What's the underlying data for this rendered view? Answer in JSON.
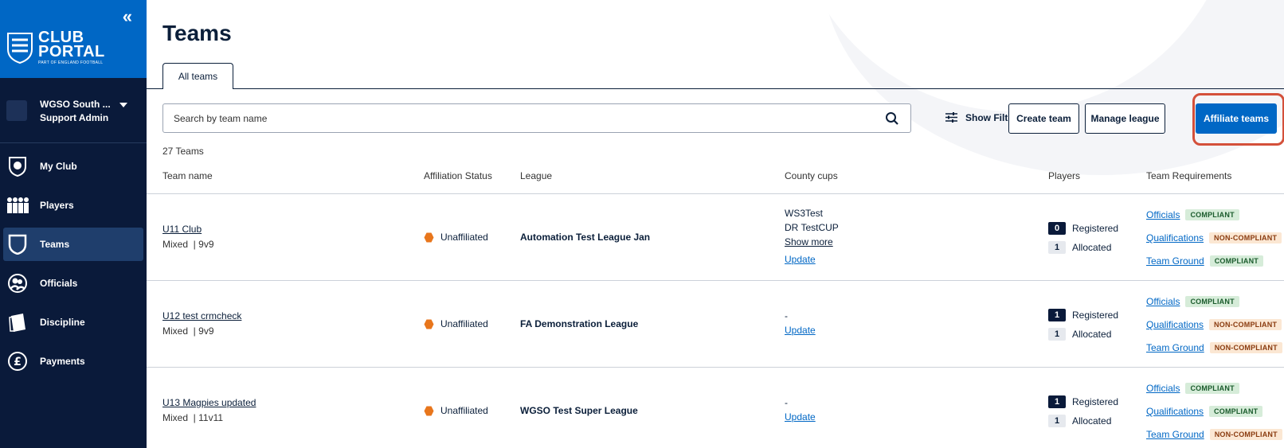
{
  "sidebar": {
    "logo": {
      "line1": "CLUB",
      "line2": "PORTAL",
      "line3": "PART OF ENGLAND FOOTBALL"
    },
    "collapse_icon": "«",
    "user": {
      "name": "WGSO South ...",
      "role": "Support Admin"
    },
    "items": [
      {
        "label": "My Club",
        "icon": "club-crest-icon"
      },
      {
        "label": "Players",
        "icon": "players-icon"
      },
      {
        "label": "Teams",
        "icon": "shield-icon"
      },
      {
        "label": "Officials",
        "icon": "officials-icon"
      },
      {
        "label": "Discipline",
        "icon": "card-icon"
      },
      {
        "label": "Payments",
        "icon": "pound-icon"
      }
    ]
  },
  "page": {
    "title": "Teams",
    "tab": "All teams",
    "search_placeholder": "Search by team name",
    "show_filters": "Show Filters",
    "buttons": {
      "create": "Create team",
      "manage": "Manage league",
      "affiliate": "Affiliate teams"
    },
    "count": "27 Teams",
    "headers": {
      "team_name": "Team name",
      "affiliation": "Affiliation Status",
      "league": "League",
      "county_cups": "County cups",
      "players": "Players",
      "requirements": "Team Requirements"
    }
  },
  "colors": {
    "sidebar": "#0a1a3a",
    "brand": "#0067c5",
    "accent_ring": "#d4503a",
    "unaffiliated": "#e8761c"
  },
  "rows": [
    {
      "name": "U11 Club",
      "gender": "Mixed",
      "format": "9v9",
      "status": "Unaffiliated",
      "league": "Automation Test League Jan",
      "cups": [
        "WS3Test",
        "DR TestCUP"
      ],
      "show_more": "Show more",
      "update": "Update",
      "registered": "0",
      "registered_label": "Registered",
      "allocated": "1",
      "allocated_label": "Allocated",
      "reqs": [
        {
          "label": "Officials",
          "status": "COMPLIANT"
        },
        {
          "label": "Qualifications",
          "status": "NON-COMPLIANT"
        },
        {
          "label": "Team Ground",
          "status": "COMPLIANT"
        }
      ]
    },
    {
      "name": "U12 test crmcheck",
      "gender": "Mixed",
      "format": "9v9",
      "status": "Unaffiliated",
      "league": "FA Demonstration League",
      "cups_dash": "-",
      "update": "Update",
      "registered": "1",
      "registered_label": "Registered",
      "allocated": "1",
      "allocated_label": "Allocated",
      "reqs": [
        {
          "label": "Officials",
          "status": "COMPLIANT"
        },
        {
          "label": "Qualifications",
          "status": "NON-COMPLIANT"
        },
        {
          "label": "Team Ground",
          "status": "NON-COMPLIANT"
        }
      ]
    },
    {
      "name": "U13 Magpies updated",
      "gender": "Mixed",
      "format": "11v11",
      "status": "Unaffiliated",
      "league": "WGSO Test Super League",
      "cups_dash": "-",
      "update": "Update",
      "registered": "1",
      "registered_label": "Registered",
      "allocated": "1",
      "allocated_label": "Allocated",
      "reqs": [
        {
          "label": "Officials",
          "status": "COMPLIANT"
        },
        {
          "label": "Qualifications",
          "status": "COMPLIANT"
        },
        {
          "label": "Team Ground",
          "status": "NON-COMPLIANT"
        }
      ]
    }
  ]
}
